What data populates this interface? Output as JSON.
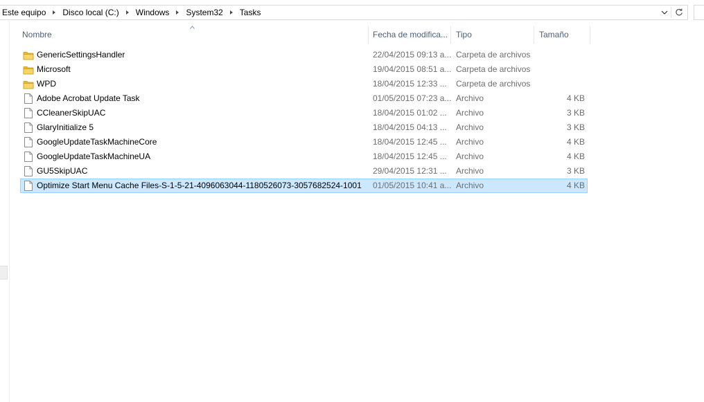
{
  "address_bar": {
    "breadcrumbs": [
      "Este equipo",
      "Disco local (C:)",
      "Windows",
      "System32",
      "Tasks"
    ],
    "dropdown_icon": "chevron-down-icon",
    "refresh_icon": "refresh-icon"
  },
  "columns": {
    "name": "Nombre",
    "date": "Fecha de modifica...",
    "type": "Tipo",
    "size": "Tamaño",
    "sorted_by": "name",
    "sort_direction": "ascending"
  },
  "files": [
    {
      "name": "GenericSettingsHandler",
      "date": "22/04/2015 09:13 a...",
      "type": "Carpeta de archivos",
      "size": "",
      "icon": "folder-icon",
      "selected": false
    },
    {
      "name": "Microsoft",
      "date": "19/04/2015 08:51 a...",
      "type": "Carpeta de archivos",
      "size": "",
      "icon": "folder-icon",
      "selected": false
    },
    {
      "name": "WPD",
      "date": "18/04/2015 12:33 ...",
      "type": "Carpeta de archivos",
      "size": "",
      "icon": "folder-icon",
      "selected": false
    },
    {
      "name": "Adobe Acrobat Update Task",
      "date": "01/05/2015 07:23 a...",
      "type": "Archivo",
      "size": "4 KB",
      "icon": "file-icon",
      "selected": false
    },
    {
      "name": "CCleanerSkipUAC",
      "date": "18/04/2015 01:02 ...",
      "type": "Archivo",
      "size": "3 KB",
      "icon": "file-icon",
      "selected": false
    },
    {
      "name": "GlaryInitialize 5",
      "date": "18/04/2015 04:13 ...",
      "type": "Archivo",
      "size": "3 KB",
      "icon": "file-icon",
      "selected": false
    },
    {
      "name": "GoogleUpdateTaskMachineCore",
      "date": "18/04/2015 12:45 ...",
      "type": "Archivo",
      "size": "4 KB",
      "icon": "file-icon",
      "selected": false
    },
    {
      "name": "GoogleUpdateTaskMachineUA",
      "date": "18/04/2015 12:45 ...",
      "type": "Archivo",
      "size": "4 KB",
      "icon": "file-icon",
      "selected": false
    },
    {
      "name": "GU5SkipUAC",
      "date": "29/04/2015 12:31 ...",
      "type": "Archivo",
      "size": "3 KB",
      "icon": "file-icon",
      "selected": false
    },
    {
      "name": "Optimize Start Menu Cache Files-S-1-5-21-4096063044-1180526073-3057682524-1001",
      "date": "01/05/2015 10:41 a...",
      "type": "Archivo",
      "size": "4 KB",
      "icon": "file-icon",
      "selected": true
    }
  ],
  "colors": {
    "header_text": "#4c607a",
    "secondary_text": "#6d6d6d",
    "selection_fill": "#cce8ff",
    "selection_border": "#99d1ff",
    "folder_yellow": "#e8b930"
  }
}
